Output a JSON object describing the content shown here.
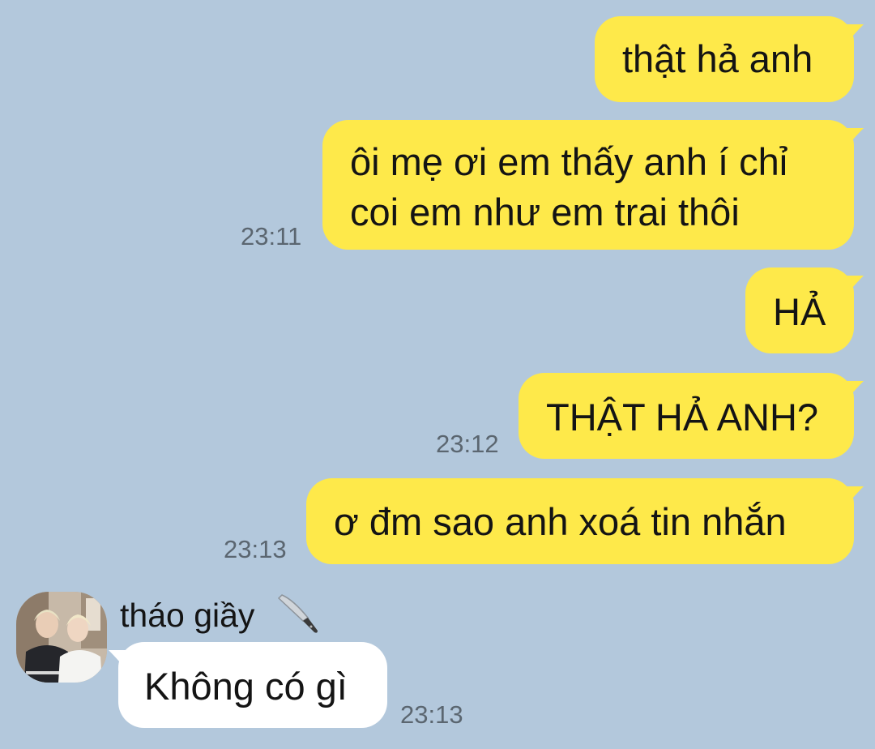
{
  "theme": {
    "background": "#b3c8dc",
    "outgoing_bubble": "#fee94a",
    "incoming_bubble": "#ffffff",
    "timestamp_color": "#5b6670"
  },
  "messages": [
    {
      "direction": "outgoing",
      "text": "thật hả anh",
      "time": ""
    },
    {
      "direction": "outgoing",
      "lines": [
        "ôi mẹ ơi em thấy anh í chỉ",
        "coi em như em trai thôi"
      ],
      "time": "23:11"
    },
    {
      "direction": "outgoing",
      "text": "HẢ",
      "time": ""
    },
    {
      "direction": "outgoing",
      "text": "THẬT HẢ ANH?",
      "time": "23:12"
    },
    {
      "direction": "outgoing",
      "text": "ơ đm sao anh xoá tin nhắn",
      "time": "23:13"
    }
  ],
  "incoming": {
    "sender_name": "tháo giầy",
    "sender_emoji_icon": "kitchen-knife-icon",
    "avatar_icon": "profile-photo-two-people",
    "text": "Không có gì",
    "time": "23:13"
  }
}
